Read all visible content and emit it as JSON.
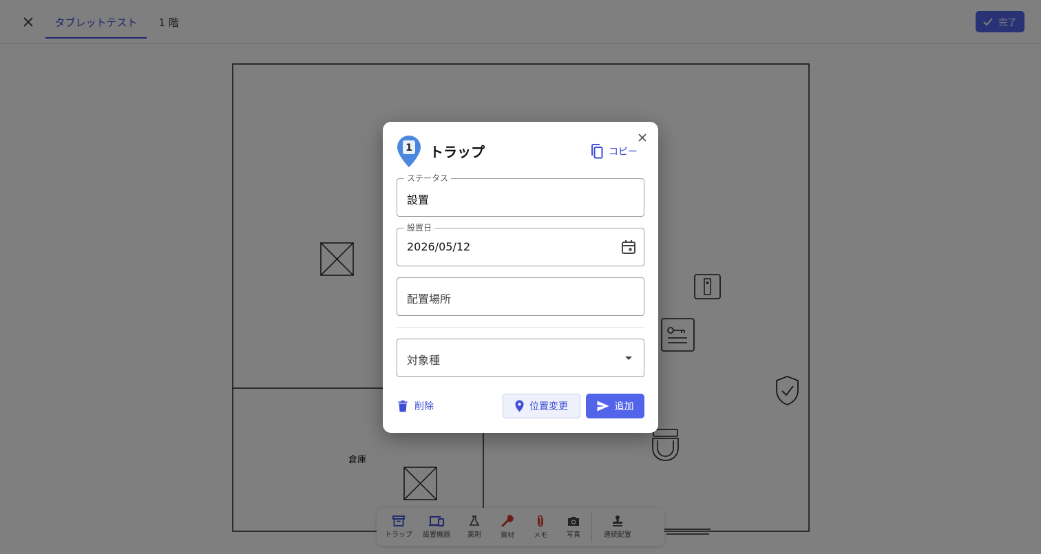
{
  "header": {
    "tabs": [
      {
        "label": "タブレットテスト",
        "active": true
      },
      {
        "label": "1 階",
        "active": false
      }
    ],
    "done_label": "完了",
    "accent_color": "#5264ea"
  },
  "floorplan": {
    "room_label": "倉庫"
  },
  "toolbar": {
    "items": [
      {
        "label": "トラップ",
        "icon": "archive-icon"
      },
      {
        "label": "設置機器",
        "icon": "devices-icon"
      },
      {
        "label": "薬剤",
        "icon": "flask-icon"
      },
      {
        "label": "資材",
        "icon": "wrench-icon"
      },
      {
        "label": "メモ",
        "icon": "paperclip-icon"
      },
      {
        "label": "写真",
        "icon": "camera-icon"
      },
      {
        "label": "連続配置",
        "icon": "stamp-icon"
      }
    ]
  },
  "dialog": {
    "marker_number": "1",
    "title": "トラップ",
    "copy_label": "コピー",
    "status": {
      "label": "ステータス",
      "value": "設置"
    },
    "install_date": {
      "label": "設置日",
      "value": "2026/05/12"
    },
    "location": {
      "placeholder": "配置場所"
    },
    "target_species": {
      "placeholder": "対象種"
    },
    "delete_label": "削除",
    "move_label": "位置変更",
    "add_label": "追加"
  }
}
